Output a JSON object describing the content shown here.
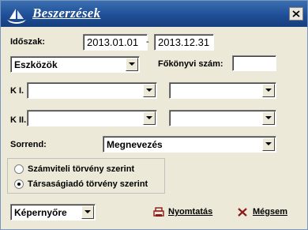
{
  "window": {
    "title": "Beszerzések",
    "close_icon": "close-icon",
    "logo_icon": "ship-logo-icon"
  },
  "period": {
    "label": "Időszak:",
    "from": "2013.01.01",
    "separator": "-",
    "to": "2013.12.31"
  },
  "category": {
    "selected": "Eszközök"
  },
  "ledger": {
    "label": "Főkönyvi szám:",
    "value": ""
  },
  "k1": {
    "label": "K I.",
    "left": "",
    "right": ""
  },
  "k2": {
    "label": "K II.",
    "left": "",
    "right": ""
  },
  "sort": {
    "label": "Sorrend:",
    "selected": "Megnevezés"
  },
  "law": {
    "options": [
      {
        "label": "Számviteli törvény szerint",
        "selected": false
      },
      {
        "label": "Társaságiadó törvény szerint",
        "selected": true
      }
    ]
  },
  "output": {
    "selected": "Képernyőre"
  },
  "actions": {
    "print_label": "Nyomtatás",
    "cancel_label": "Mégsem",
    "print_icon": "printer-icon",
    "cancel_icon": "x-icon"
  }
}
